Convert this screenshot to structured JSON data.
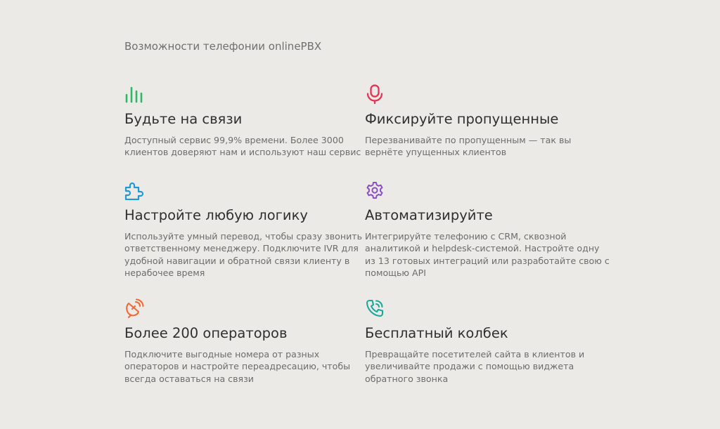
{
  "section": {
    "title": "Возможности телефонии onlinePBX"
  },
  "features": [
    {
      "icon": "bar-chart-icon",
      "color": "#2fb86a",
      "title": "Будьте на связи",
      "desc_lines": [
        "Доступный сервис 99,9% времени. Более 3000",
        "клиентов доверяют нам и используют наш сервис"
      ]
    },
    {
      "icon": "microphone-icon",
      "color": "#e53354",
      "title": "Фиксируйте пропущенные",
      "desc_lines": [
        "Перезванивайте по пропущенным — так вы",
        "вернёте упущенных клиентов"
      ]
    },
    {
      "icon": "puzzle-icon",
      "color": "#1f9ad6",
      "title": "Настройте любую логику",
      "desc_lines": [
        "Используйте умный перевод, чтобы сразу звонить",
        "ответственному менеджеру. Подключите IVR для",
        "удобной навигации и обратной связи клиенту в",
        "нерабочее время"
      ]
    },
    {
      "icon": "gear-icon",
      "color": "#8a4fc8",
      "title": "Автоматизируйте",
      "desc_lines": [
        "Интегрируйте телефонию с CRM, сквозной",
        "аналитикой и helpdesk-системой. Настройте одну",
        "из 13 готовых интеграций или разработайте свою с",
        "помощью API"
      ]
    },
    {
      "icon": "satellite-dish-icon",
      "color": "#ef6a35",
      "title": "Более 200 операторов",
      "desc_lines": [
        "Подключите выгодные номера от разных",
        "операторов и настройте переадресацию, чтобы",
        "всегда оставаться на связи"
      ]
    },
    {
      "icon": "phone-calling-icon",
      "color": "#1ca89a",
      "title": "Бесплатный колбек",
      "desc_lines": [
        "Превращайте посетителей сайта в клиентов и",
        "увеличивайте продажи с помощью виджета",
        "обратного звонка"
      ]
    }
  ]
}
